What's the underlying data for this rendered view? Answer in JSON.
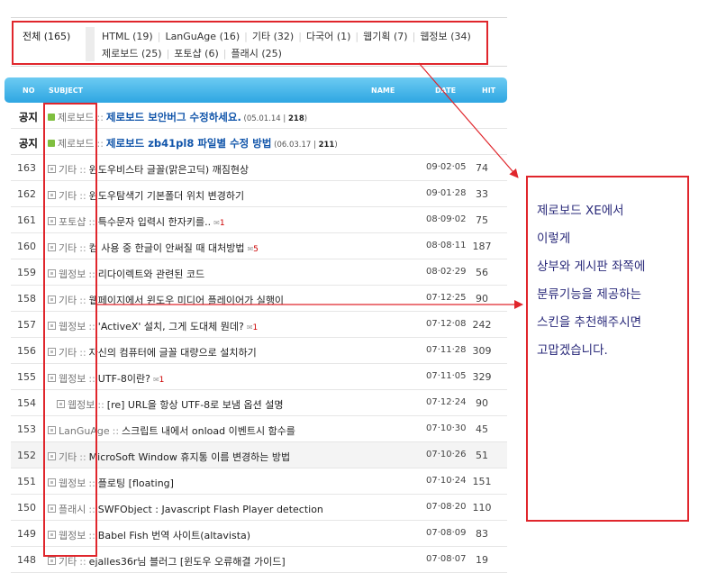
{
  "categories": {
    "all": {
      "label": "전체",
      "count": "(165)"
    },
    "items": [
      {
        "label": "HTML",
        "count": "(19)"
      },
      {
        "label": "LanGuAge",
        "count": "(16)"
      },
      {
        "label": "기타",
        "count": "(32)"
      },
      {
        "label": "다국어",
        "count": "(1)"
      },
      {
        "label": "웹기획",
        "count": "(7)"
      },
      {
        "label": "웹정보",
        "count": "(34)"
      },
      {
        "label": "제로보드",
        "count": "(25)"
      },
      {
        "label": "포토샵",
        "count": "(6)"
      },
      {
        "label": "플래시",
        "count": "(25)"
      }
    ]
  },
  "table_header": {
    "no": "NO",
    "subject": "SUBJECT",
    "name": "NAME",
    "date": "DATE",
    "hit": "HIT"
  },
  "notices": [
    {
      "no": "공지",
      "category": "제로보드",
      "title": "제로보드 보안버그 수정하세요.",
      "date": "05.01.14",
      "hits": "218"
    },
    {
      "no": "공지",
      "category": "제로보드",
      "title": "제로보드 zb41pl8 파일별 수정 방법",
      "date": "06.03.17",
      "hits": "211"
    }
  ],
  "posts": [
    {
      "no": "163",
      "category": "기타",
      "title": "윈도우비스타 글꼴(맑은고딕) 깨짐현상",
      "comments": "",
      "date": "09·02·05",
      "hits": "74"
    },
    {
      "no": "162",
      "category": "기타",
      "title": "윈도우탐색기 기본폴더 위치 변경하기",
      "comments": "",
      "date": "09·01·28",
      "hits": "33"
    },
    {
      "no": "161",
      "category": "포토샵",
      "title": "특수문자 입력시 한자키를..",
      "comments": "1",
      "date": "08·09·02",
      "hits": "75"
    },
    {
      "no": "160",
      "category": "기타",
      "title": "컴 사용 중 한글이 안써질 때 대처방법",
      "comments": "5",
      "date": "08·08·11",
      "hits": "187"
    },
    {
      "no": "159",
      "category": "웹정보",
      "title": "리다이렉트와 관련된 코드",
      "comments": "",
      "date": "08·02·29",
      "hits": "56"
    },
    {
      "no": "158",
      "category": "기타",
      "title": "웹페이지에서 윈도우 미디어 플레이어가 실행이",
      "comments": "",
      "date": "07·12·25",
      "hits": "90"
    },
    {
      "no": "157",
      "category": "웹정보",
      "title": "'ActiveX' 설치, 그게 도대체 뭔데?",
      "comments": "1",
      "date": "07·12·08",
      "hits": "242"
    },
    {
      "no": "156",
      "category": "기타",
      "title": "자신의 컴퓨터에 글꼴 대량으로 설치하기",
      "comments": "",
      "date": "07·11·28",
      "hits": "309"
    },
    {
      "no": "155",
      "category": "웹정보",
      "title": "UTF-8이란?",
      "comments": "1",
      "date": "07·11·05",
      "hits": "329"
    },
    {
      "no": "154",
      "category": "웹정보",
      "title": "[re] URL을 항상 UTF-8로 보냄 옵션 설명",
      "comments": "",
      "date": "07·12·24",
      "hits": "90",
      "reply": true
    },
    {
      "no": "153",
      "category": "LanGuAge",
      "title": "스크립트 내에서 onload 이벤트시 함수를",
      "comments": "",
      "date": "07·10·30",
      "hits": "45"
    },
    {
      "no": "152",
      "category": "기타",
      "title": "MicroSoft Window 휴지통 이름 변경하는 방법",
      "comments": "",
      "date": "07·10·26",
      "hits": "51"
    },
    {
      "no": "151",
      "category": "웹정보",
      "title": "플로팅 [floating]",
      "comments": "",
      "date": "07·10·24",
      "hits": "151"
    },
    {
      "no": "150",
      "category": "플래시",
      "title": "SWFObject : Javascript Flash Player detection",
      "comments": "",
      "date": "07·08·20",
      "hits": "110"
    },
    {
      "no": "149",
      "category": "웹정보",
      "title": "Babel Fish 번역 사이트(altavista)",
      "comments": "",
      "date": "07·08·09",
      "hits": "83"
    },
    {
      "no": "148",
      "category": "기타",
      "title": "ejalles36r님 블러그 [윈도우 오류해결 가이드]",
      "comments": "",
      "date": "07·08·07",
      "hits": "19"
    }
  ],
  "annotation": {
    "lines": [
      "제로보드 XE에서",
      "이렇게",
      "상부와 게시판 좌쪽에",
      "분류기능을 제공하는",
      "스킨을 추천해주시면",
      "고맙겠습니다."
    ]
  },
  "colors": {
    "highlight": "#e0262c",
    "header": "#3cb0e6",
    "notice_title": "#1155aa"
  }
}
